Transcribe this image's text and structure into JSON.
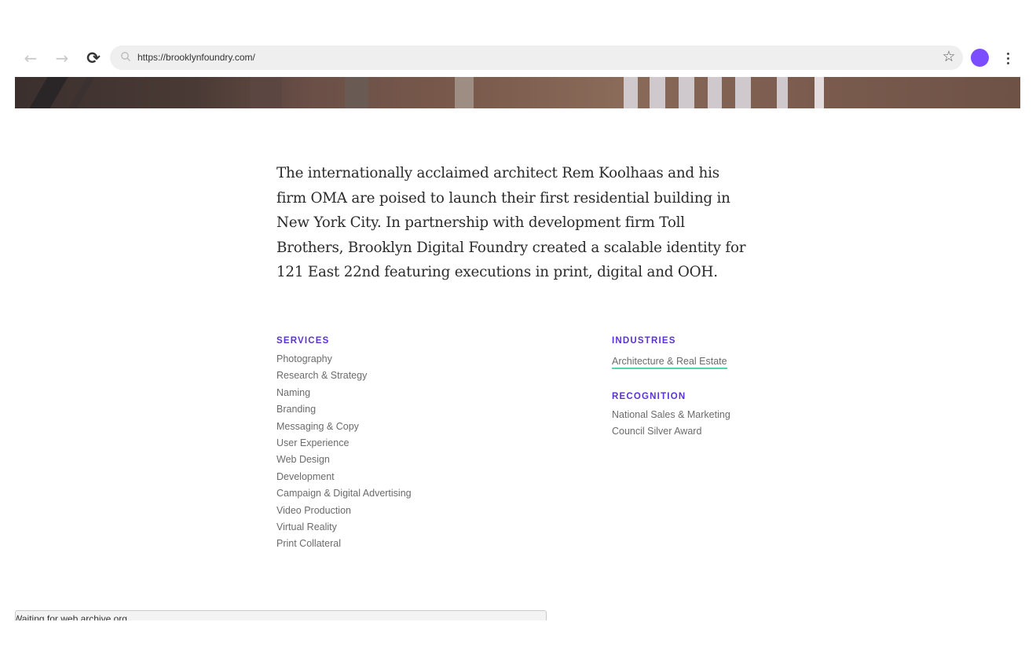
{
  "browser": {
    "back_glyph": "←",
    "forward_glyph": "→",
    "reload_glyph": "⟳",
    "url": "https://brooklynfoundry.com/",
    "star_glyph": "☆",
    "avatar_color": "#7c4dff"
  },
  "intro": {
    "text": "The internationally acclaimed architect Rem Koolhaas and his firm OMA are poised to launch their first residential building in New York City. In partnership with development firm Toll Brothers, Brooklyn Digital Foundry created a scalable identity for 121 East 22nd featuring executions in print, digital and OOH."
  },
  "services": {
    "heading": "SERVICES",
    "items": [
      "Photography",
      "Research & Strategy",
      "Naming",
      "Branding",
      "Messaging & Copy",
      "User Experience",
      "Web Design",
      "Development",
      "Campaign & Digital Advertising",
      "Video Production",
      "Virtual Reality",
      "Print Collateral"
    ]
  },
  "industries": {
    "heading": "INDUSTRIES",
    "items": [
      "Architecture & Real Estate"
    ]
  },
  "recognition": {
    "heading": "RECOGNITION",
    "items": [
      "National Sales & Marketing",
      "Council Silver Award"
    ]
  },
  "status": {
    "text": "Waiting for web.archive.org..."
  },
  "colors": {
    "accent": "#5a32d6",
    "link_underline": "#4fd8a8"
  }
}
